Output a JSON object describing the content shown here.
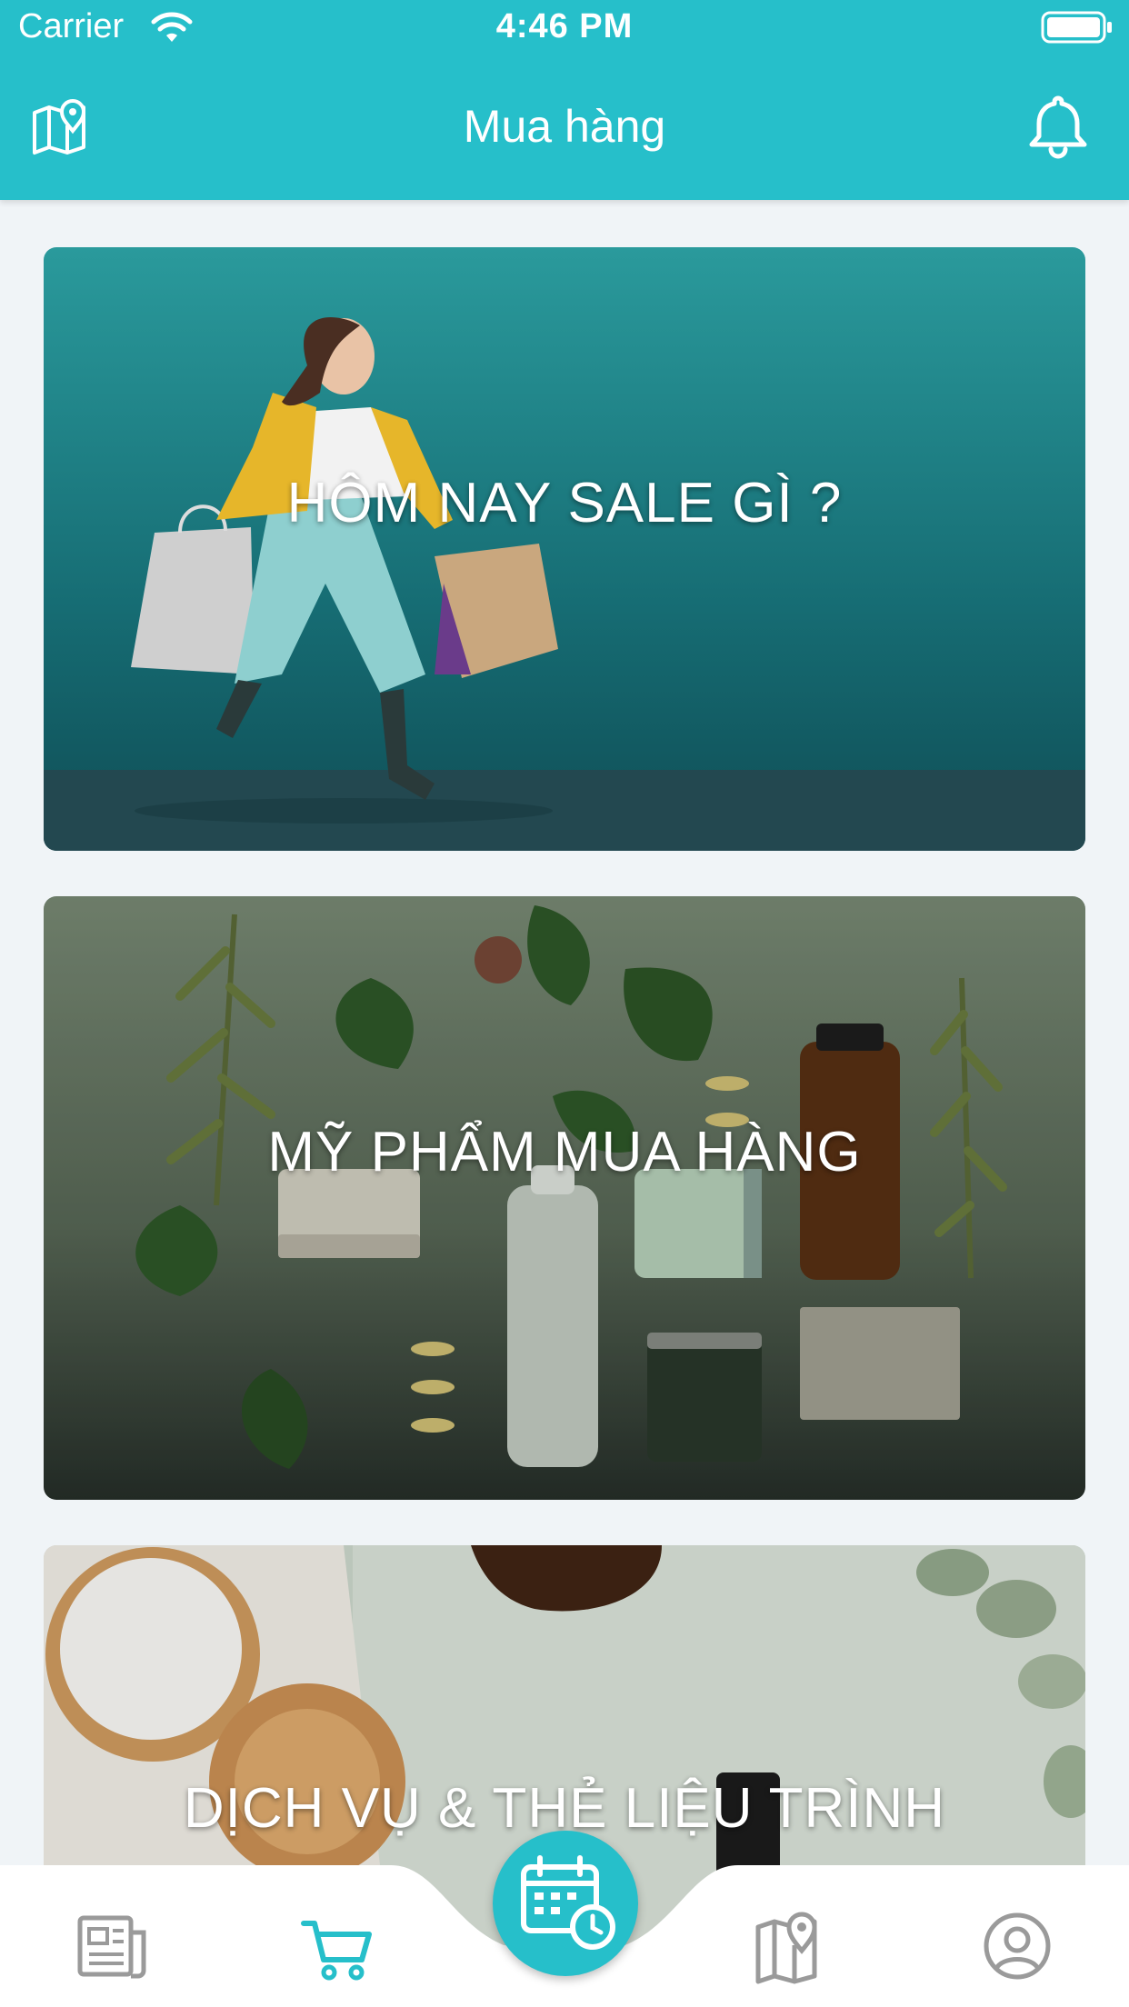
{
  "status_bar": {
    "carrier": "Carrier",
    "time": "4:46 PM"
  },
  "header": {
    "title": "Mua hàng"
  },
  "cards": [
    {
      "title": "HÔM NAY SALE GÌ ?"
    },
    {
      "title": "MỸ PHẨM MUA HÀNG"
    },
    {
      "title": "DỊCH VỤ & THẺ LIỆU TRÌNH"
    }
  ],
  "tabs": [
    {
      "icon": "news-icon",
      "active": false
    },
    {
      "icon": "cart-icon",
      "active": true
    },
    {
      "icon": "calendar-clock-icon",
      "center": true
    },
    {
      "icon": "map-icon",
      "active": false
    },
    {
      "icon": "profile-icon",
      "active": false
    }
  ],
  "colors": {
    "accent": "#26bfca",
    "inactive_icon": "#9a9a9a",
    "background": "#f0f4f7"
  }
}
